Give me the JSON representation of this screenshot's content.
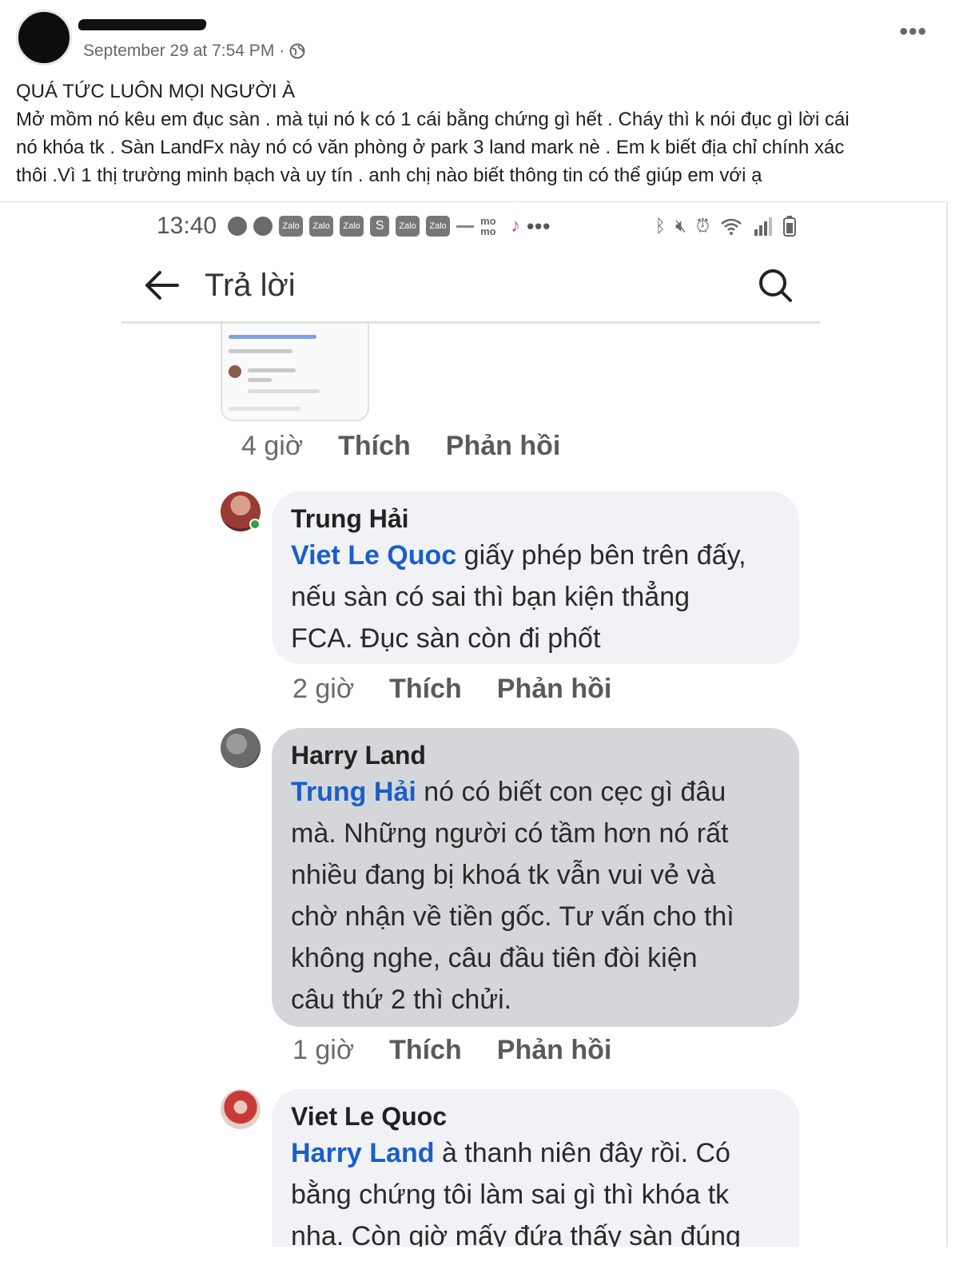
{
  "post": {
    "timestamp": "September 29 at 7:54 PM",
    "separator": "·",
    "more_label": "•••",
    "lines": [
      "QUÁ TỨC LUÔN MỌI NGƯỜI À",
      "Mở mồm nó kêu em đục sàn . mà tụi nó k có 1 cái bằng chứng gì hết . Cháy thì k nói đục gì lời cái",
      "nó khóa tk . Sàn LandFx này nó có văn phòng ở park 3 land mark nè . Em k biết địa chỉ chính xác",
      "thôi .Vì 1 thị trường minh bạch và uy tín . anh chị nào biết thông tin có thể giúp em với ạ"
    ]
  },
  "screenshot": {
    "status": {
      "time": "13:40",
      "app_icons": [
        "Zalo",
        "Zalo",
        "Zalo",
        "S",
        "Zalo",
        "Zalo",
        "mo mo"
      ],
      "dots": "•••"
    },
    "app_bar": {
      "title": "Trả lời"
    },
    "first_actions": {
      "time": "4 giờ",
      "like": "Thích",
      "reply": "Phản hồi"
    },
    "comments": [
      {
        "author": "Trung Hải",
        "mention": "Viet Le Quoc",
        "lines": [
          "giấy phép bên trên đấy,",
          "nếu sàn có sai thì bạn kiện thẳng",
          "FCA. Đục sàn còn đi phốt"
        ],
        "time": "2 giờ",
        "like": "Thích",
        "reply": "Phản hồi"
      },
      {
        "author": "Harry Land",
        "mention": "Trung Hải",
        "lines": [
          "nó có biết con cẹc gì đâu",
          "mà. Những người có tầm hơn nó rất",
          "nhiều đang bị khoá tk vẫn vui vẻ và",
          "chờ nhận về tiền gốc. Tư vấn cho thì",
          "không nghe, câu đầu tiên đòi kiện",
          "câu thứ 2 thì chửi."
        ],
        "time": "1 giờ",
        "like": "Thích",
        "reply": "Phản hồi"
      },
      {
        "author": "Viet Le Quoc",
        "mention": "Harry Land",
        "lines": [
          "à thanh niên đây rồi. Có",
          "bằng chứng tôi làm sai gì thì khóa tk",
          "nha. Còn giờ mấy đứa thấy sàn đúng"
        ]
      }
    ]
  },
  "colors": {
    "mention": "#1b5ec9",
    "bubble_light": "#f0f2f5",
    "bubble_highlight": "#d4d6d9",
    "meta_gray": "#65676b"
  }
}
